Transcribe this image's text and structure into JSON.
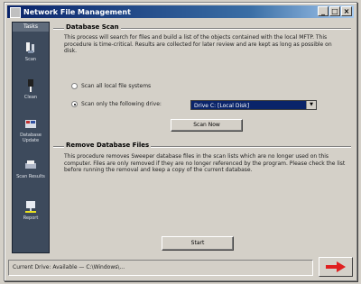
{
  "window": {
    "title": "Network File Management"
  },
  "sidebar": {
    "header": "Tasks",
    "items": [
      {
        "label": "Scan"
      },
      {
        "label": "Clean"
      },
      {
        "label": "Database Update"
      },
      {
        "label": "Scan Results"
      },
      {
        "label": "Report"
      }
    ]
  },
  "main": {
    "section1": {
      "title": "Database Scan",
      "description": "This process will search for files and build a list of the objects contained with the local MFTP. This procedure is time-critical. Results are collected for later review and are kept as long as possible on disk.",
      "radio_options": [
        {
          "label": "Scan all local file systems",
          "selected": false
        },
        {
          "label": "Scan only the following drive:",
          "selected": true
        }
      ],
      "drive_value": "Drive C: [Local Disk]",
      "action_button": "Scan Now"
    },
    "section2": {
      "title": "Remove Database Files",
      "description": "This procedure removes Sweeper database files in the scan lists which are no longer used on this computer. Files are only removed if they are no longer referenced by the program. Please check the list before running the removal and keep a copy of the current database."
    },
    "footer_button": "Start"
  },
  "statusbar": {
    "text": "Current Drive: Available — C:\\Windows\\..."
  },
  "colors": {
    "accent": "#0a246a",
    "next_arrow": "#e02020"
  }
}
